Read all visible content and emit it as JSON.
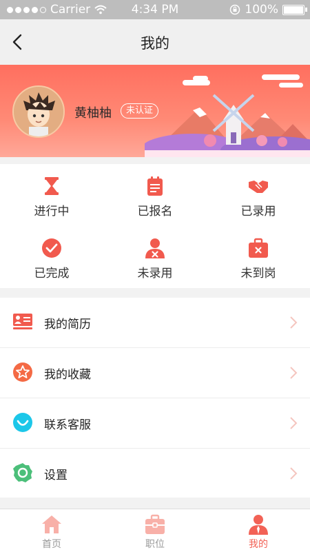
{
  "status_bar": {
    "carrier": "Carrier",
    "time": "4:34 PM",
    "battery": "100%"
  },
  "nav": {
    "title": "我的"
  },
  "profile": {
    "name": "黄柚柚",
    "verify_badge": "未认证"
  },
  "status_grid": [
    {
      "label": "进行中",
      "icon": "hourglass-icon"
    },
    {
      "label": "已报名",
      "icon": "clipboard-icon"
    },
    {
      "label": "已录用",
      "icon": "handshake-icon"
    },
    {
      "label": "已完成",
      "icon": "check-circle-icon"
    },
    {
      "label": "未录用",
      "icon": "person-x-icon"
    },
    {
      "label": "未到岗",
      "icon": "briefcase-x-icon"
    }
  ],
  "menu": [
    {
      "label": "我的简历",
      "icon": "resume-icon"
    },
    {
      "label": "我的收藏",
      "icon": "star-icon"
    },
    {
      "label": "联系客服",
      "icon": "headset-icon"
    },
    {
      "label": "设置",
      "icon": "gear-icon"
    }
  ],
  "tabs": [
    {
      "label": "首页",
      "icon": "home-icon"
    },
    {
      "label": "职位",
      "icon": "briefcase-icon"
    },
    {
      "label": "我的",
      "icon": "profile-icon",
      "active": true
    }
  ],
  "colors": {
    "accent": "#f26256",
    "banner": "#ff7a68"
  }
}
